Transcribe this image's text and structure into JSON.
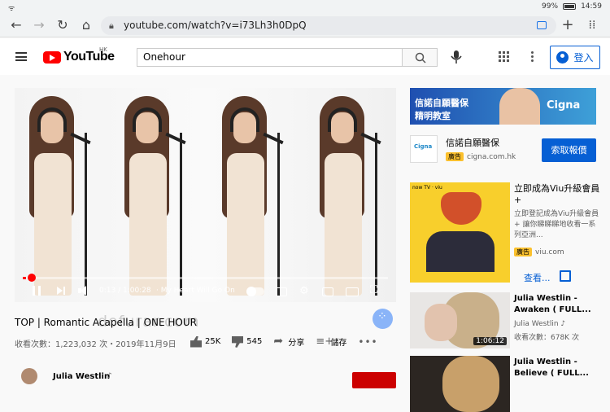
{
  "status": {
    "battery": "99%",
    "time": "14:59"
  },
  "browser": {
    "url": "youtube.com/watch?v=i73Lh3h0DpQ"
  },
  "header": {
    "logo_text": "YouTube",
    "region": "HK",
    "search_value": "Onehour",
    "signin_label": "登入"
  },
  "player": {
    "time": "0:13 / 1:00:28",
    "chapter": "· My Heart Will Go On",
    "progress": 0.004
  },
  "video": {
    "title": "TOP | Romantic Acapella | ONE HOUR",
    "meta": "收看次數：1,223,032 次・2019年11月9日",
    "likes": "25K",
    "dislikes": "545",
    "share_label": "分享",
    "save_label": "儲存",
    "watermark": "dofurar.com"
  },
  "channel": {
    "name": "Julia Westlin",
    "note_icon": "♪"
  },
  "ads": {
    "banner": {
      "line1": "信諾自願醫保",
      "line2": "精明教室",
      "brand": "Cigna"
    },
    "sponsor": {
      "logo": "Cigna",
      "title": "信諾自願醫保",
      "badge": "廣告",
      "host": "cigna.com.hk",
      "cta": "索取報價"
    },
    "viu": {
      "title": "立即成為Viu升級會員+",
      "desc": "立即登記成為Viu升級會員+ 讓你睇睇睇地收看一系列亞洲...",
      "badge": "廣告",
      "host": "viu.com",
      "view_label": "查看...",
      "logo": "now TV · viu"
    }
  },
  "recommendations": [
    {
      "title": "Julia Westlin - Awaken ( FULL...",
      "channel": "Julia Westlin ♪",
      "views": "收看次數：678K 次",
      "duration": "1:06:12"
    },
    {
      "title": "Julia Westlin - Believe ( FULL...",
      "channel": "",
      "views": "",
      "duration": ""
    }
  ],
  "colors": {
    "accent": "#065fd4",
    "brand_red": "#ff0000"
  }
}
